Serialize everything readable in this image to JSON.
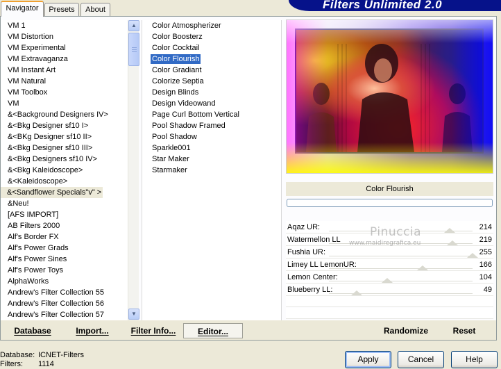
{
  "tabs": [
    {
      "label": "Navigator",
      "active": true
    },
    {
      "label": "Presets",
      "active": false
    },
    {
      "label": "About",
      "active": false
    }
  ],
  "banner": {
    "title": "Filters Unlimited 2.0"
  },
  "categories": [
    "VM 1",
    "VM Distortion",
    "VM Experimental",
    "VM Extravaganza",
    "VM Instant Art",
    "VM Natural",
    "VM Toolbox",
    "VM",
    "&<Background Designers IV>",
    "&<Bkg Designer sf10 I>",
    "&<BKg Designer sf10 II>",
    "&<Bkg Designer sf10 III>",
    "&<Bkg Designers sf10 IV>",
    "&<Bkg Kaleidoscope>",
    "&<Kaleidoscope>",
    "&<Sandflower Specials\"v\" >",
    "&Neu!",
    "[AFS IMPORT]",
    "AB Filters 2000",
    "Alf's Border FX",
    "Alf's Power Grads",
    "Alf's Power Sines",
    "Alf's Power Toys",
    "AlphaWorks",
    "Andrew's Filter Collection 55",
    "Andrew's Filter Collection 56",
    "Andrew's Filter Collection 57"
  ],
  "selected_category": "&<Sandflower Specials\"v\" >",
  "filters": [
    "Color Atmospherizer",
    "Color Boosterz",
    "Color Cocktail",
    "Color Flourish",
    "Color Gradiant",
    "Colorize Septia",
    "Design Blinds",
    "Design Videowand",
    "Page Curl Bottom Vertical",
    "Pool Shadow Framed",
    "Pool Shadow",
    "Sparkle001",
    "Star Maker",
    "Starmaker"
  ],
  "selected_filter": "Color Flourish",
  "preview": {
    "caption": "Color Flourish"
  },
  "sliders": [
    {
      "label": "Aqaz UR:",
      "value": 214,
      "max": 255
    },
    {
      "label": "Watermellon LL",
      "value": 219,
      "max": 255
    },
    {
      "label": "Fushia UR:",
      "value": 255,
      "max": 255
    },
    {
      "label": "Limey LL LemonUR:",
      "value": 166,
      "max": 255
    },
    {
      "label": "Lemon Center:",
      "value": 104,
      "max": 255
    },
    {
      "label": "Blueberry LL:",
      "value": 49,
      "max": 255
    }
  ],
  "watermark": {
    "name": "Pinuccia",
    "url": "www.maidiregrafica.eu"
  },
  "toolbar": {
    "database": "Database",
    "import": "Import...",
    "filter_info": "Filter Info...",
    "editor": "Editor...",
    "randomize": "Randomize",
    "reset": "Reset"
  },
  "status": {
    "database_label": "Database:",
    "database_value": "ICNET-Filters",
    "filters_label": "Filters:",
    "filters_value": "1114"
  },
  "dialog": {
    "apply": "Apply",
    "cancel": "Cancel",
    "help": "Help"
  }
}
